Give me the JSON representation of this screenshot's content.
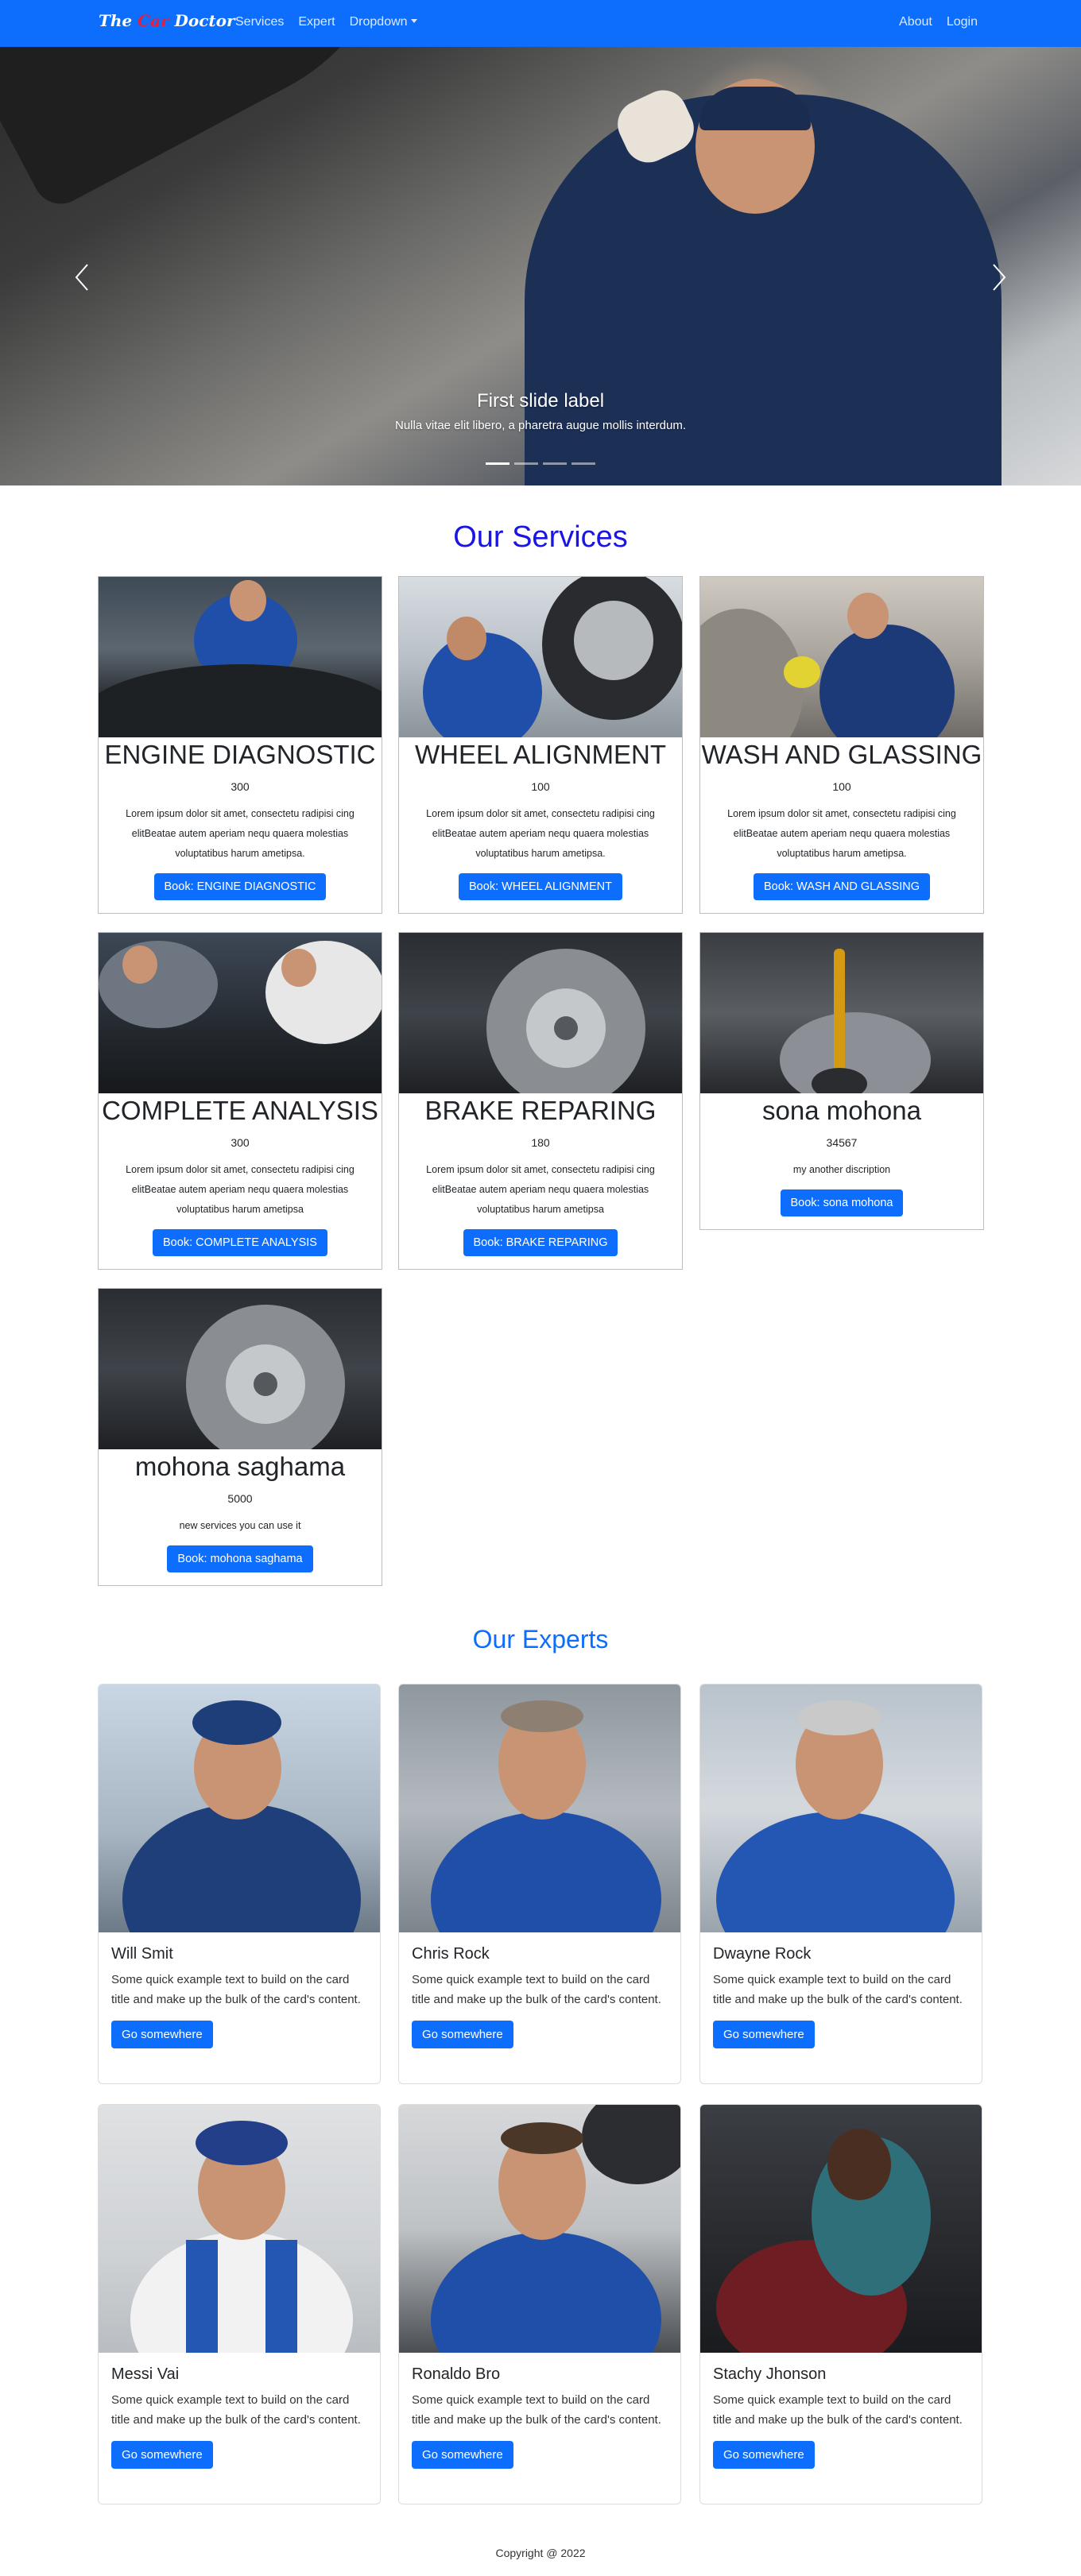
{
  "navbar": {
    "brand": {
      "part1": "The ",
      "part2": "Car",
      "part3": " Doctor"
    },
    "left_links": [
      "Services",
      "Expert",
      "Dropdown"
    ],
    "right_links": [
      "About",
      "Login"
    ]
  },
  "carousel": {
    "caption_title": "First slide label",
    "caption_text": "Nulla vitae elit libero, a pharetra augue mollis interdum.",
    "slide_count": 4,
    "active_slide": 1
  },
  "services": {
    "heading": "Our Services",
    "items": [
      {
        "name": "ENGINE DIAGNOSTIC",
        "price": "300",
        "description": "Lorem ipsum dolor sit amet, consectetu radipisi cing elitBeatae autem aperiam nequ quaera molestias voluptatibus harum ametipsa.",
        "button": "Book: ENGINE DIAGNOSTIC"
      },
      {
        "name": "WHEEL ALIGNMENT",
        "price": "100",
        "description": "Lorem ipsum dolor sit amet, consectetu radipisi cing elitBeatae autem aperiam nequ quaera molestias voluptatibus harum ametipsa.",
        "button": "Book: WHEEL ALIGNMENT"
      },
      {
        "name": "WASH AND GLASSING",
        "price": "100",
        "description": "Lorem ipsum dolor sit amet, consectetu radipisi cing elitBeatae autem aperiam nequ quaera molestias voluptatibus harum ametipsa.",
        "button": "Book: WASH AND GLASSING"
      },
      {
        "name": "COMPLETE ANALYSIS",
        "price": "300",
        "description": "Lorem ipsum dolor sit amet, consectetu radipisi cing elitBeatae autem aperiam nequ quaera molestias voluptatibus harum ametipsa",
        "button": "Book: COMPLETE ANALYSIS"
      },
      {
        "name": "BRAKE REPARING",
        "price": "180",
        "description": "Lorem ipsum dolor sit amet, consectetu radipisi cing elitBeatae autem aperiam nequ quaera molestias voluptatibus harum ametipsa",
        "button": "Book: BRAKE REPARING"
      },
      {
        "name": "sona mohona",
        "price": "34567",
        "description": "my another discription",
        "button": "Book: sona mohona"
      },
      {
        "name": "mohona saghama",
        "price": "5000",
        "description": "new services you can use it",
        "button": "Book: mohona saghama"
      }
    ]
  },
  "experts": {
    "heading": "Our Experts",
    "items": [
      {
        "name": "Will Smit",
        "text": "Some quick example text to build on the card title and make up the bulk of the card's content.",
        "button": "Go somewhere"
      },
      {
        "name": "Chris Rock",
        "text": "Some quick example text to build on the card title and make up the bulk of the card's content.",
        "button": "Go somewhere"
      },
      {
        "name": "Dwayne Rock",
        "text": "Some quick example text to build on the card title and make up the bulk of the card's content.",
        "button": "Go somewhere"
      },
      {
        "name": "Messi Vai",
        "text": "Some quick example text to build on the card title and make up the bulk of the card's content.",
        "button": "Go somewhere"
      },
      {
        "name": "Ronaldo Bro",
        "text": "Some quick example text to build on the card title and make up the bulk of the card's content.",
        "button": "Go somewhere"
      },
      {
        "name": "Stachy Jhonson",
        "text": "Some quick example text to build on the card title and make up the bulk of the card's content.",
        "button": "Go somewhere"
      }
    ]
  },
  "footer": {
    "text": "Copyright @ 2022"
  },
  "colors": {
    "primary": "#0d6efd",
    "services_heading": "#1a14e6",
    "brand_accent": "#e02040"
  },
  "icons": {
    "carousel_prev": "chevron-left-icon",
    "carousel_next": "chevron-right-icon",
    "dropdown": "caret-down-icon"
  }
}
